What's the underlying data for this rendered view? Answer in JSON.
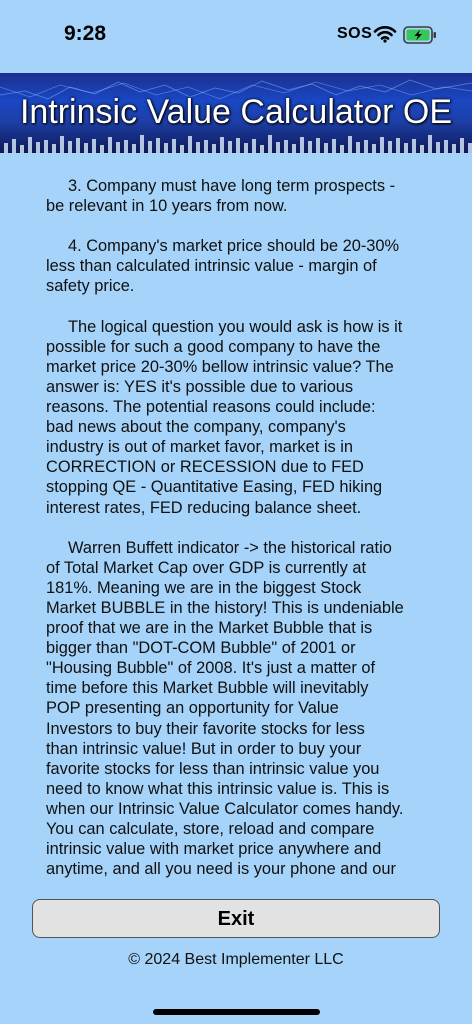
{
  "status_bar": {
    "time": "9:28",
    "carrier": "SOS"
  },
  "header": {
    "title": "Intrinsic Value Calculator OE"
  },
  "main": {
    "paragraphs": [
      "3. Company must have long term prospects -\nbe relevant in 10 years from now.",
      "4. Company's market price should be 20-30%\nless than calculated intrinsic value - margin of\nsafety price.",
      "The logical question you would ask is how is it\npossible for such a good company to have the\nmarket price 20-30% bellow intrinsic value? The\nanswer is: YES it's possible due to various\nreasons. The potential reasons could include:\nbad news about the company, company's\nindustry is out of market favor, market is in\nCORRECTION or RECESSION due to FED\nstopping QE - Quantitative Easing, FED hiking\ninterest rates, FED reducing balance sheet.",
      "Warren Buffett indicator -> the historical ratio\nof Total Market Cap over GDP is currently at\n181%. Meaning we are in the biggest Stock\nMarket BUBBLE in the history! This is undeniable\nproof that we are in the Market Bubble that is\nbigger than \"DOT-COM Bubble\" of 2001 or\n\"Housing Bubble\" of 2008. It's just a matter of\ntime before this Market Bubble will inevitably\nPOP presenting an opportunity for Value\nInvestors to buy their favorite stocks for less\nthan intrinsic value! But in order to buy your\nfavorite stocks for less than intrinsic value you\nneed to know what this intrinsic value is.  This is\nwhen our Intrinsic Value Calculator comes handy.\nYou can calculate, store, reload and compare\nintrinsic value with market price anywhere and\nanytime, and all you need is your phone and our"
    ]
  },
  "footer": {
    "exit_label": "Exit",
    "copyright": "© 2024 Best Implementer LLC"
  },
  "colors": {
    "background": "#a6d3f9",
    "banner": "#1a47c4",
    "button": "#e2e2e2"
  }
}
